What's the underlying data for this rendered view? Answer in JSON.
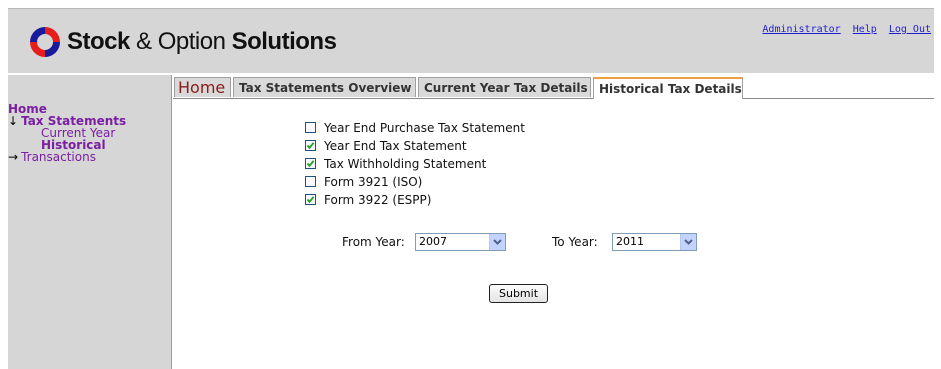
{
  "brand": {
    "name_bold_1": "Stock",
    "name_amp": " & Option ",
    "name_bold_2": "Solutions",
    "logo_icon": "sos-logo-icon",
    "colors": {
      "logo_red": "#e61e1e",
      "logo_blue": "#1a1a9c"
    }
  },
  "toplinks": {
    "administrator": "Administrator",
    "help": "Help",
    "logout": "Log Out"
  },
  "sidebar": {
    "home": "Home",
    "tax_statements_arrow": "↓",
    "tax_statements": "Tax Statements",
    "current_year": "Current Year",
    "historical": "Historical",
    "transactions_arrow": "→",
    "transactions": "Transactions"
  },
  "tabs": [
    {
      "label": "Home"
    },
    {
      "label": "Tax Statements Overview"
    },
    {
      "label": "Current Year Tax Details"
    },
    {
      "label": "Historical Tax Details",
      "active": true
    }
  ],
  "options": [
    {
      "label": "Year End Purchase Tax Statement",
      "checked": false
    },
    {
      "label": "Year End Tax Statement",
      "checked": true
    },
    {
      "label": "Tax Withholding Statement",
      "checked": true
    },
    {
      "label": "Form 3921 (ISO)",
      "checked": false
    },
    {
      "label": "Form 3922 (ESPP)",
      "checked": true
    }
  ],
  "years": {
    "from_label": "From Year:",
    "from_value": "2007",
    "to_label": "To Year:",
    "to_value": "2011"
  },
  "submit_label": "Submit",
  "colors": {
    "header_bg": "#d6d6d6",
    "nav_purple": "#7a1fa2",
    "link_blue": "#1f1fd2",
    "active_tab_accent": "#f0a040",
    "home_tab_red": "#8b1a1a"
  }
}
